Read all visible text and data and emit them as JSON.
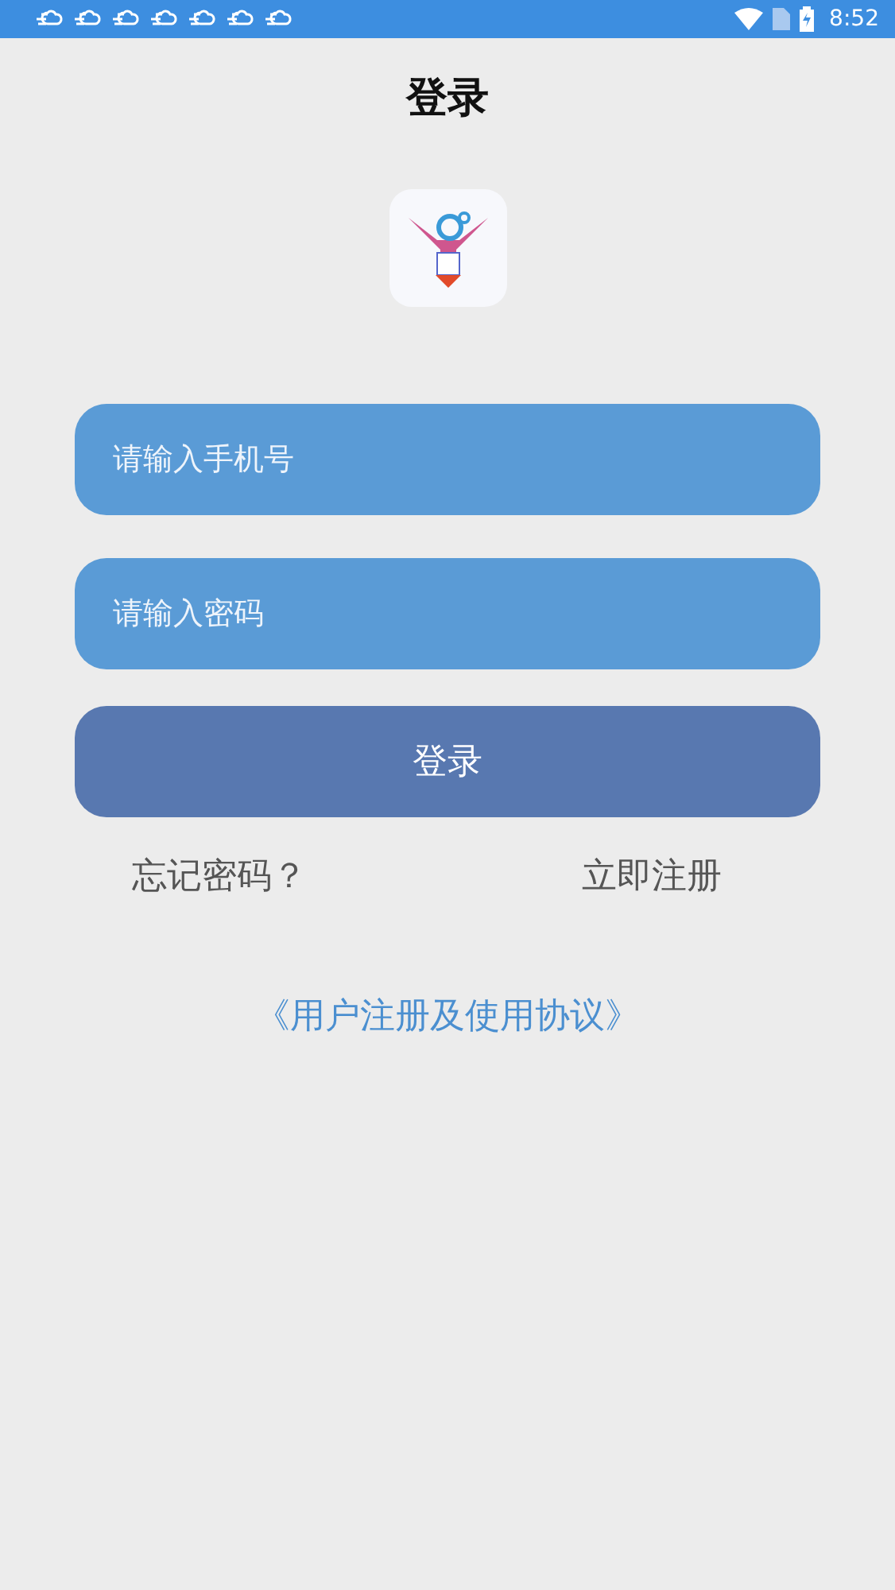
{
  "status_bar": {
    "notifications": [
      {
        "kind": "cloud"
      },
      {
        "kind": "cloud"
      },
      {
        "kind": "cloud"
      },
      {
        "kind": "cloud"
      },
      {
        "kind": "cloud"
      },
      {
        "kind": "cloud"
      },
      {
        "kind": "cloud"
      }
    ],
    "time": "8:52"
  },
  "title": "登录",
  "phone_field": {
    "placeholder": "请输入手机号"
  },
  "password_field": {
    "placeholder": "请输入密码"
  },
  "login_button": "登录",
  "forgot_link": "忘记密码？",
  "register_link": "立即注册",
  "agreement_link": "《用户注册及使用协议》"
}
